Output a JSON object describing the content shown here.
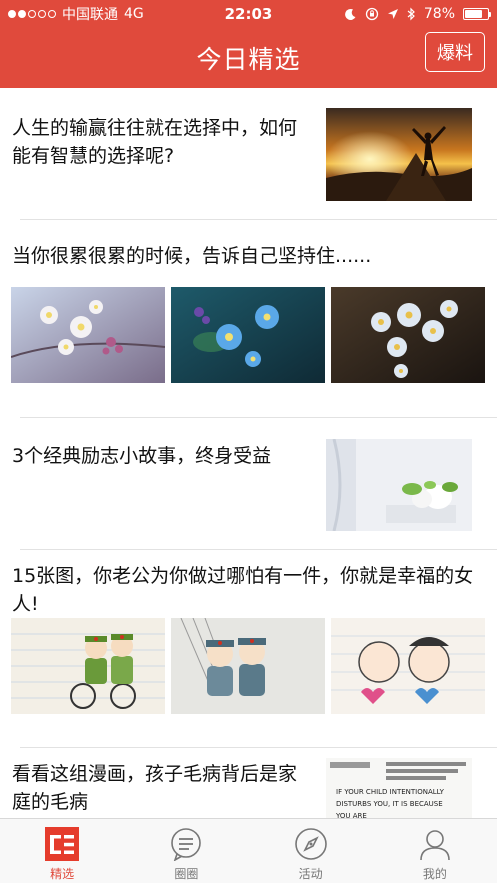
{
  "status_bar": {
    "carrier": "中国联通",
    "network": "4G",
    "time": "22:03",
    "battery": "78%",
    "battery_level": 0.78
  },
  "nav": {
    "title": "今日精选",
    "report_label": "爆料"
  },
  "articles": [
    {
      "title": "人生的输赢往往就在选择中，如何能有智慧的选择呢?",
      "layout": "single-image",
      "image": "sunset-silhouette"
    },
    {
      "title": "当你很累很累的时候，告诉自己坚持住......",
      "layout": "three-images",
      "images": [
        "flowers-white",
        "flowers-blue",
        "flowers-white-blue"
      ]
    },
    {
      "title": "3个经典励志小故事，终身受益",
      "layout": "single-image",
      "image": "white-flower-pot"
    },
    {
      "title": "15张图，你老公为你做过哪怕有一件，你就是幸福的女人!",
      "layout": "three-images",
      "images": [
        "cartoon-couple-bike",
        "cartoon-couple-uniform",
        "cartoon-couple-hearts"
      ]
    },
    {
      "title": "看看这组漫画，孩子毛病背后是家庭的毛病",
      "layout": "single-image",
      "image": "poster-text"
    }
  ],
  "poster_text": {
    "line1": "IF YOUR CHILD INTENTIONALLY",
    "line2": "DISTURBS YOU, IT IS BECAUSE",
    "line3": "YOU ARE"
  },
  "tabs": [
    {
      "label": "精选",
      "icon": "selected-icon",
      "active": true
    },
    {
      "label": "圈圈",
      "icon": "chat-bubble-icon",
      "active": false
    },
    {
      "label": "活动",
      "icon": "compass-icon",
      "active": false
    },
    {
      "label": "我的",
      "icon": "user-icon",
      "active": false
    }
  ],
  "colors": {
    "brand": "#e04a3c",
    "separator": "#e2e2e2",
    "tab_inactive": "#777777"
  }
}
